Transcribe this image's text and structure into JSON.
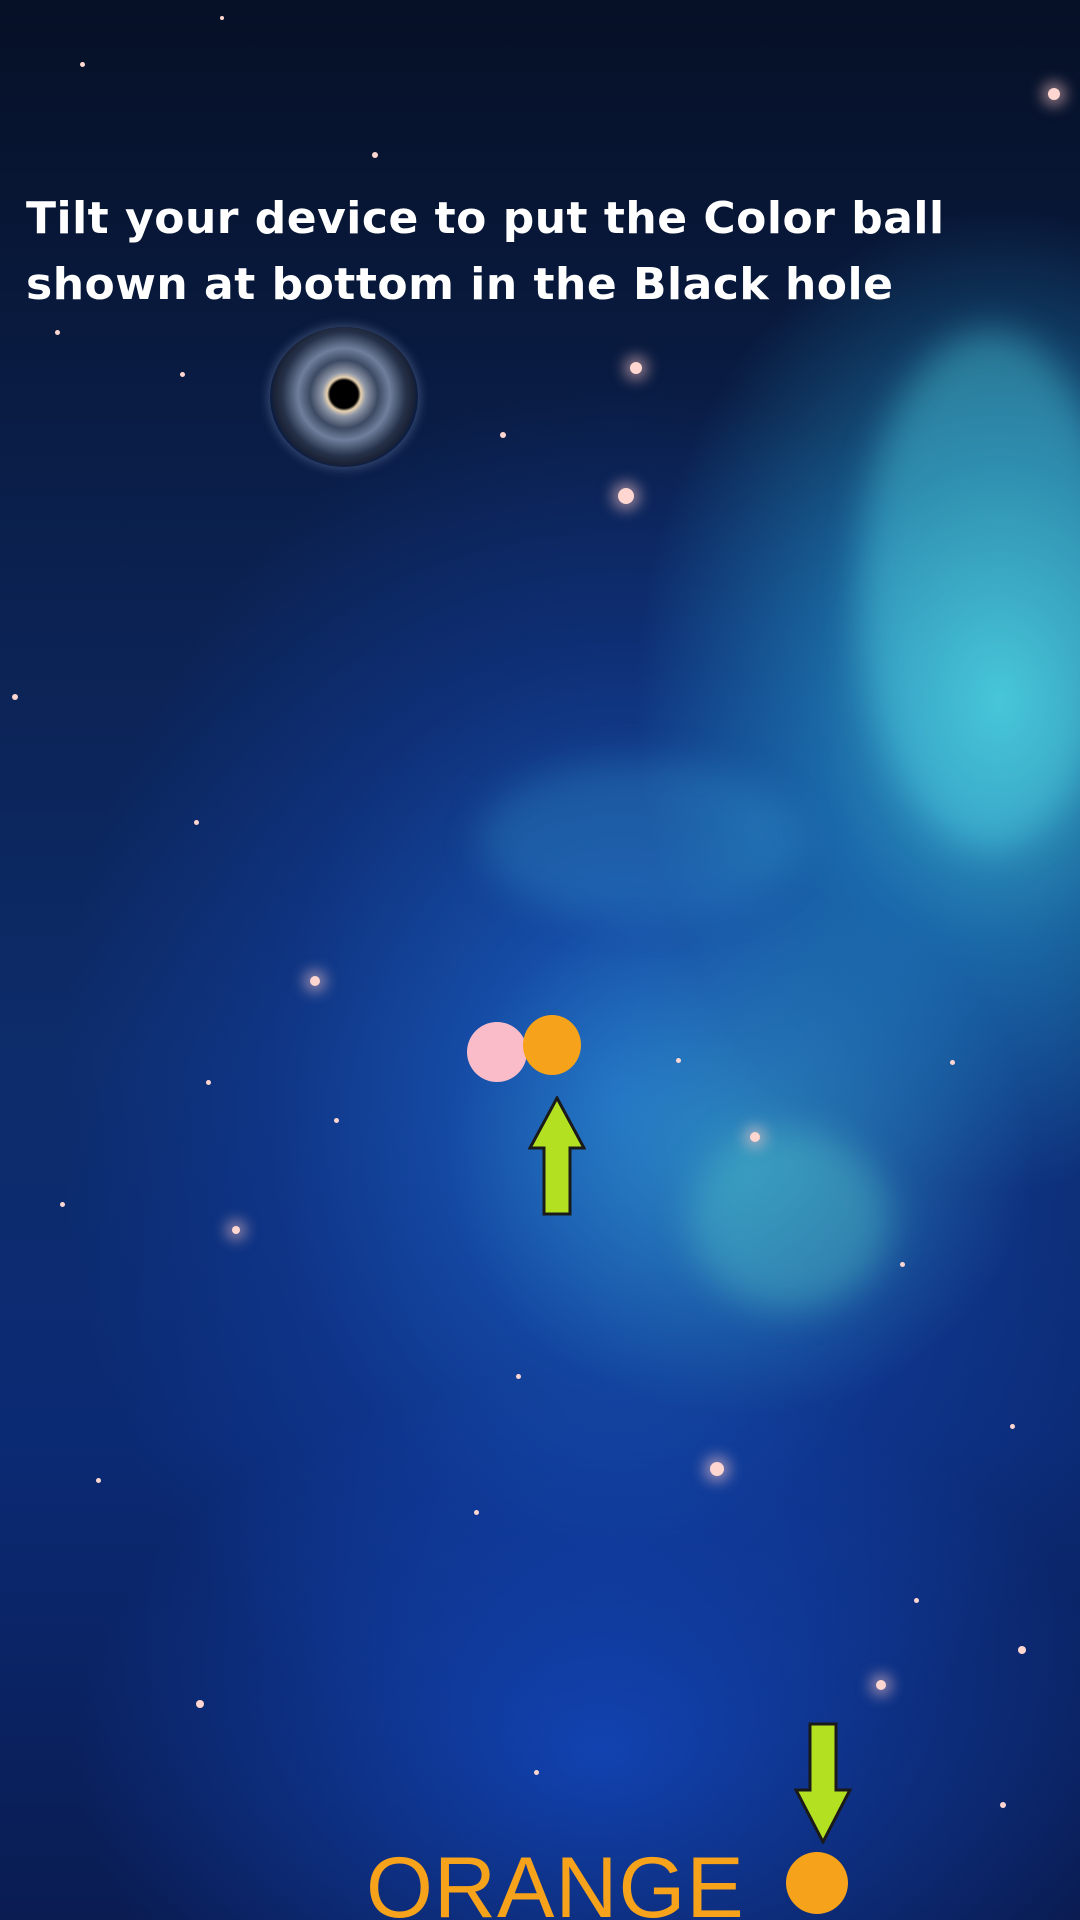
{
  "instruction": "Tilt your device to put the Color ball shown at bottom in the Black hole",
  "target": {
    "label": "ORANGE",
    "color": "#f6a21a"
  },
  "balls": [
    {
      "name": "pink",
      "color": "#f9bcc8"
    },
    {
      "name": "orange",
      "color": "#f6a21a"
    }
  ],
  "arrows": {
    "fill": "#b3e121",
    "stroke": "#1a1a1a",
    "up_icon": "arrow-up-icon",
    "down_icon": "arrow-down-icon"
  },
  "colors": {
    "space_dark": "#061026",
    "space_blue": "#0d2c6b",
    "nebula_cyan": "#50e6f0",
    "text": "#ffffff"
  }
}
